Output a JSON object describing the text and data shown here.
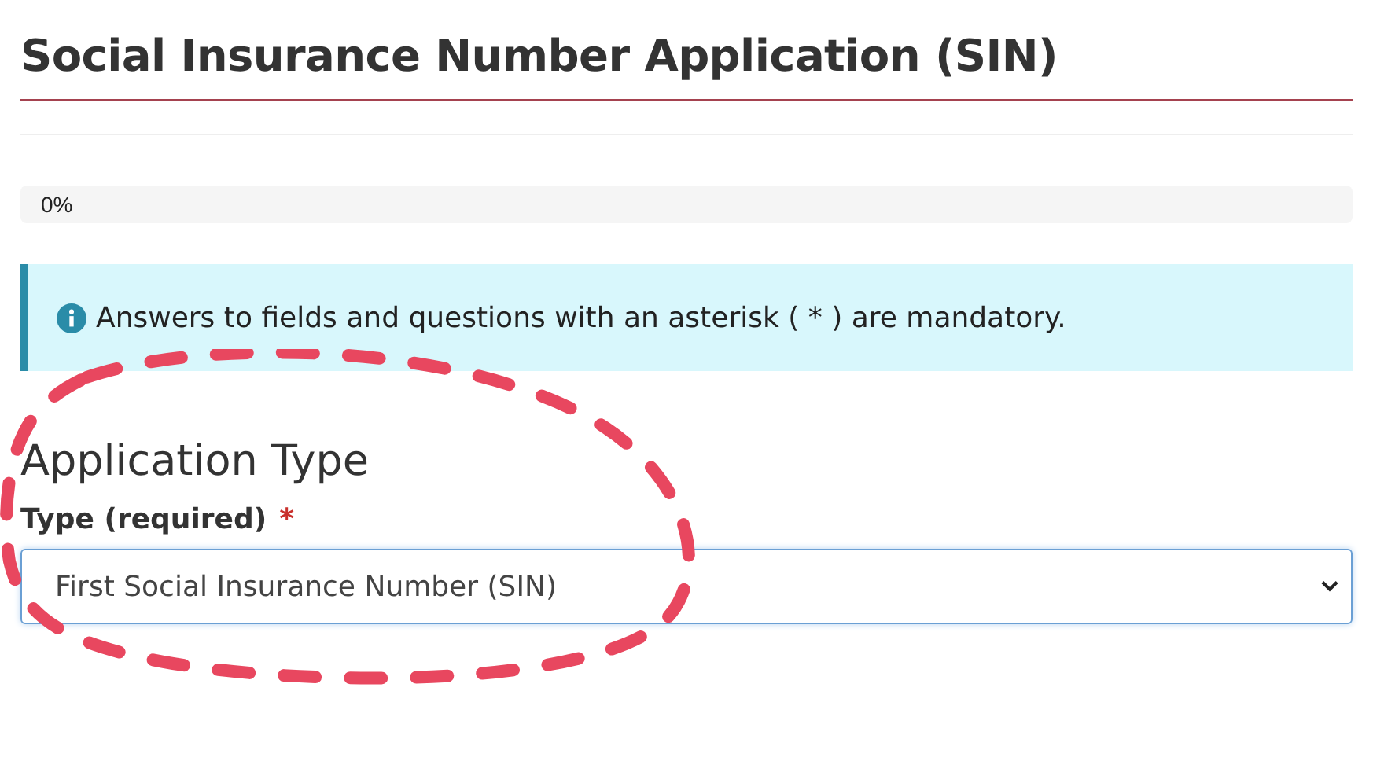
{
  "page_title": "Social Insurance Number Application (SIN)",
  "progress": {
    "level": 0,
    "reading": "0%"
  },
  "alert": {
    "text": "Answers to fields and questions with an asterisk ( * ) are mandatory."
  },
  "section": {
    "heading": "Application Type",
    "field": {
      "label": "Type (required)",
      "required_mark": "*",
      "value": "First Social Insurance Number (SIN)"
    }
  },
  "annotation": {
    "kind": "dashed-ellipse",
    "color": "#e8475f"
  }
}
